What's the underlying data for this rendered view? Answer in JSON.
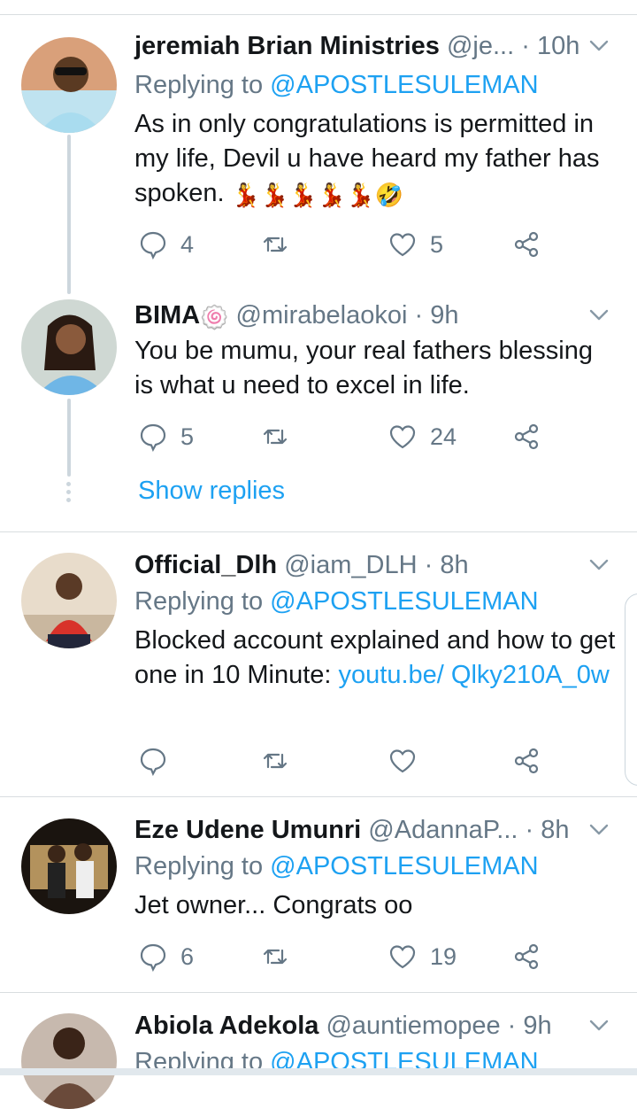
{
  "tweets": [
    {
      "name": "jeremiah Brian Ministries",
      "handle": "@je...",
      "time": "10h",
      "replying_prefix": "Replying to",
      "replying_to": "@APOSTLESULEMAN",
      "text": "As in only  congratulations is permitted in my life, Devil u have heard my father has spoken.",
      "emojis": "💃💃💃💃💃🤣",
      "replies": "4",
      "retweets": "",
      "likes": "5"
    },
    {
      "name": "BIMA",
      "name_emoji": "🍥",
      "handle": "@mirabelaokoi",
      "time": "9h",
      "text": "You be mumu, your real fathers blessing is what u need to excel in life.",
      "replies": "5",
      "retweets": "",
      "likes": "24",
      "show_replies": "Show replies"
    },
    {
      "name": "Official_Dlh",
      "handle": "@iam_DLH",
      "time": "8h",
      "replying_prefix": "Replying to",
      "replying_to": "@APOSTLESULEMAN",
      "text": "Blocked account explained and how to get one in 10 Minute:",
      "link": "youtu.be/ Qlky210A_0w",
      "replies": "",
      "retweets": "",
      "likes": ""
    },
    {
      "name": "Eze Udene Umunri",
      "handle": "@AdannaP...",
      "time": "8h",
      "replying_prefix": "Replying to",
      "replying_to": "@APOSTLESULEMAN",
      "text": "Jet owner... Congrats oo",
      "replies": "6",
      "retweets": "",
      "likes": "19"
    },
    {
      "name": "Abiola Adekola",
      "handle": "@auntiemopee",
      "time": "9h",
      "replying_prefix": "Replying to",
      "replying_to": "@APOSTLESULEMAN"
    }
  ],
  "colors": {
    "accent": "#1da1f2",
    "secondary_text": "#657786",
    "divider": "#d9dde0"
  },
  "icons": [
    "reply-icon",
    "retweet-icon",
    "like-icon",
    "share-icon",
    "chevron-down-icon"
  ]
}
